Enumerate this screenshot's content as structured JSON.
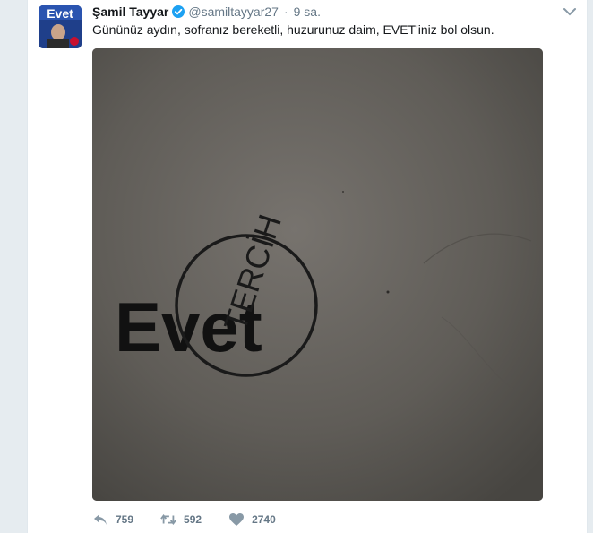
{
  "tweet": {
    "author_name": "Şamil Tayyar",
    "handle": "@samiltayyar27",
    "time": "9 sa.",
    "text": "Günün​üz aydın, sofranız bereketli, huzurunuz daim, EVET'iniz bol olsun.",
    "avatar_text": "Evet",
    "image": {
      "stamp_word": "Evet",
      "seal_text": "TERCİH"
    },
    "actions": {
      "reply_count": "759",
      "retweet_count": "592",
      "like_count": "2740"
    }
  },
  "colors": {
    "background": "#e6ecf0",
    "card": "#ffffff",
    "name": "#14171a",
    "meta": "#657786",
    "verified": "#1da1f2"
  }
}
